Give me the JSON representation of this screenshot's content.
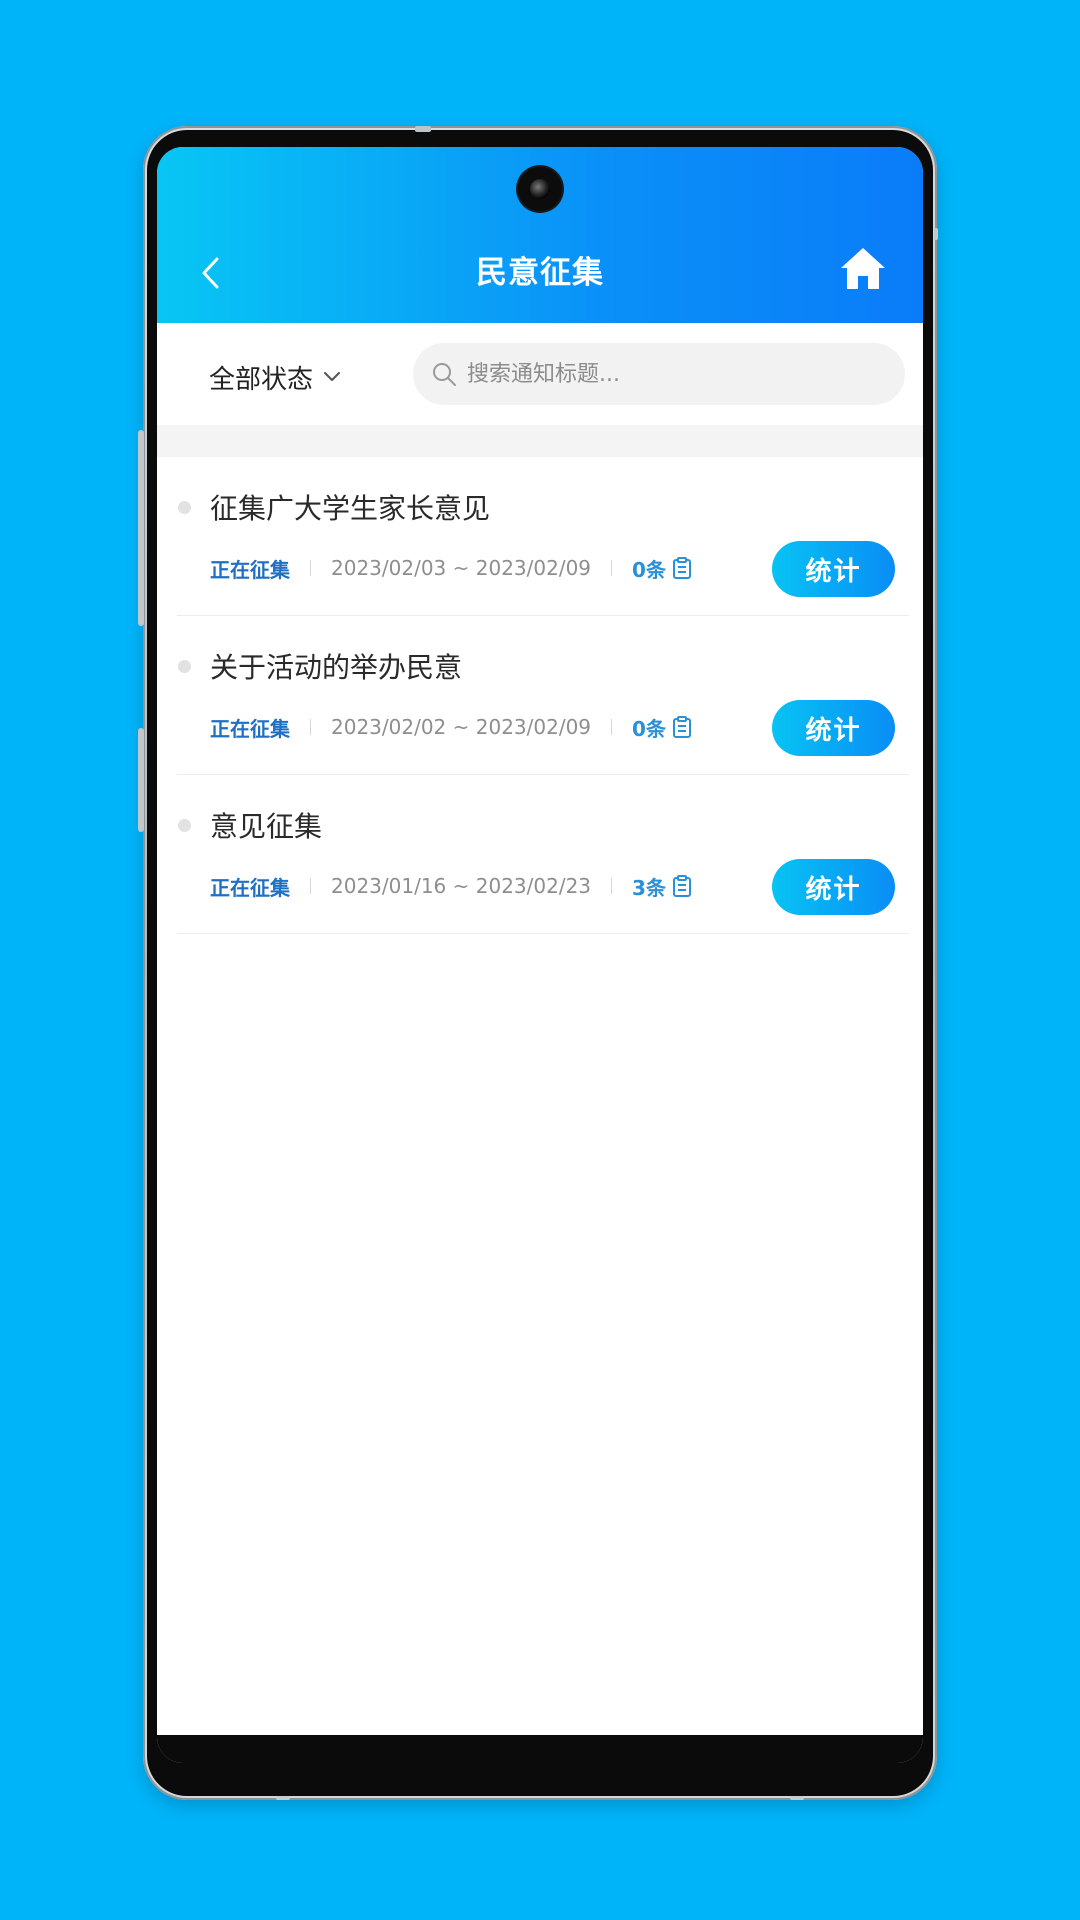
{
  "header": {
    "title": "民意征集"
  },
  "filter": {
    "status_label": "全部状态",
    "search_placeholder": "搜索通知标题..."
  },
  "items": [
    {
      "title": "征集广大学生家长意见",
      "status": "正在征集",
      "date_range": "2023/02/03 ~ 2023/02/09",
      "count": "0条",
      "button": "统计"
    },
    {
      "title": "关于活动的举办民意",
      "status": "正在征集",
      "date_range": "2023/02/02 ~ 2023/02/09",
      "count": "0条",
      "button": "统计"
    },
    {
      "title": "意见征集",
      "status": "正在征集",
      "date_range": "2023/01/16 ~ 2023/02/23",
      "count": "3条",
      "button": "统计"
    }
  ],
  "icons": [
    "back-icon",
    "home-icon",
    "chevron-down-icon",
    "search-icon",
    "clipboard-icon"
  ],
  "colors": {
    "background": "#00b4fa",
    "header_start": "#08c6f4",
    "header_end": "#0a7cf9",
    "status": "#1f6fc5",
    "count": "#2a90d8"
  }
}
